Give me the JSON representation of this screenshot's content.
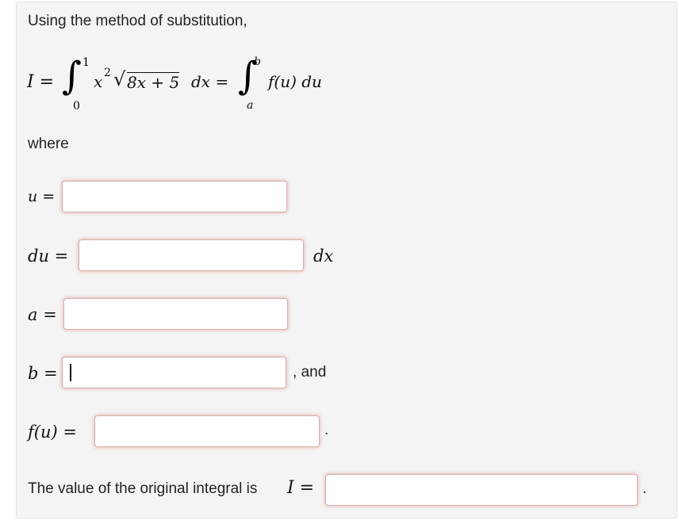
{
  "intro_text": "Using the method of substitution,",
  "integral": {
    "lhs": "I =",
    "upper_1": "1",
    "lower_1": "0",
    "x_base": "x",
    "x_exp": "2",
    "radicand": "8x + 5",
    "dx": "dx =",
    "upper_2": "b",
    "lower_2": "a",
    "rhs_body": "f(u) du"
  },
  "where_text": "where",
  "fields": {
    "u_label": "u =",
    "du_label": "du =",
    "du_suffix": "dx",
    "a_label": "a =",
    "b_label": "b =",
    "b_suffix": ", and",
    "f_label": "f(u) =",
    "f_suffix": "."
  },
  "final": {
    "text": "The value of the original integral is",
    "var": "I =",
    "suffix": "."
  },
  "values": {
    "u": "",
    "du": "",
    "a": "",
    "b": "",
    "f": "",
    "I": ""
  }
}
